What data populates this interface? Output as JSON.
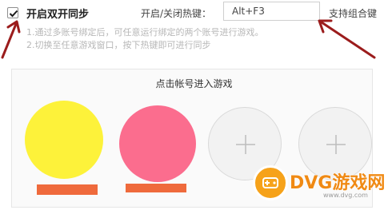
{
  "top": {
    "sync_checkbox_checked": true,
    "sync_label": "开启双开同步",
    "hotkey_label": "开启/关闭热键：",
    "hotkey_value": "Alt+F3",
    "combo_note": "支持组合键"
  },
  "hints": [
    "1.通过多账号绑定后，可任意运行绑定的两个账号进行游戏。",
    "2.切换至任意游戏窗口，按下热键即可进行同步"
  ],
  "accounts": {
    "title": "点击帐号进入游戏",
    "slots": [
      {
        "state": "filled",
        "color": "#fdf23a",
        "bar_color": "#ef6a3c"
      },
      {
        "state": "filled",
        "color": "#fb6d8e",
        "bar_color": "#ef6a3c"
      },
      {
        "state": "empty",
        "icon": "plus-icon"
      },
      {
        "state": "empty",
        "icon": "plus-icon"
      }
    ]
  },
  "watermark": {
    "brand": "DVG游戏网",
    "url": "www.dvg.com"
  },
  "colors": {
    "arrow": "#9b1c1c",
    "watermark": "#f08a14"
  }
}
